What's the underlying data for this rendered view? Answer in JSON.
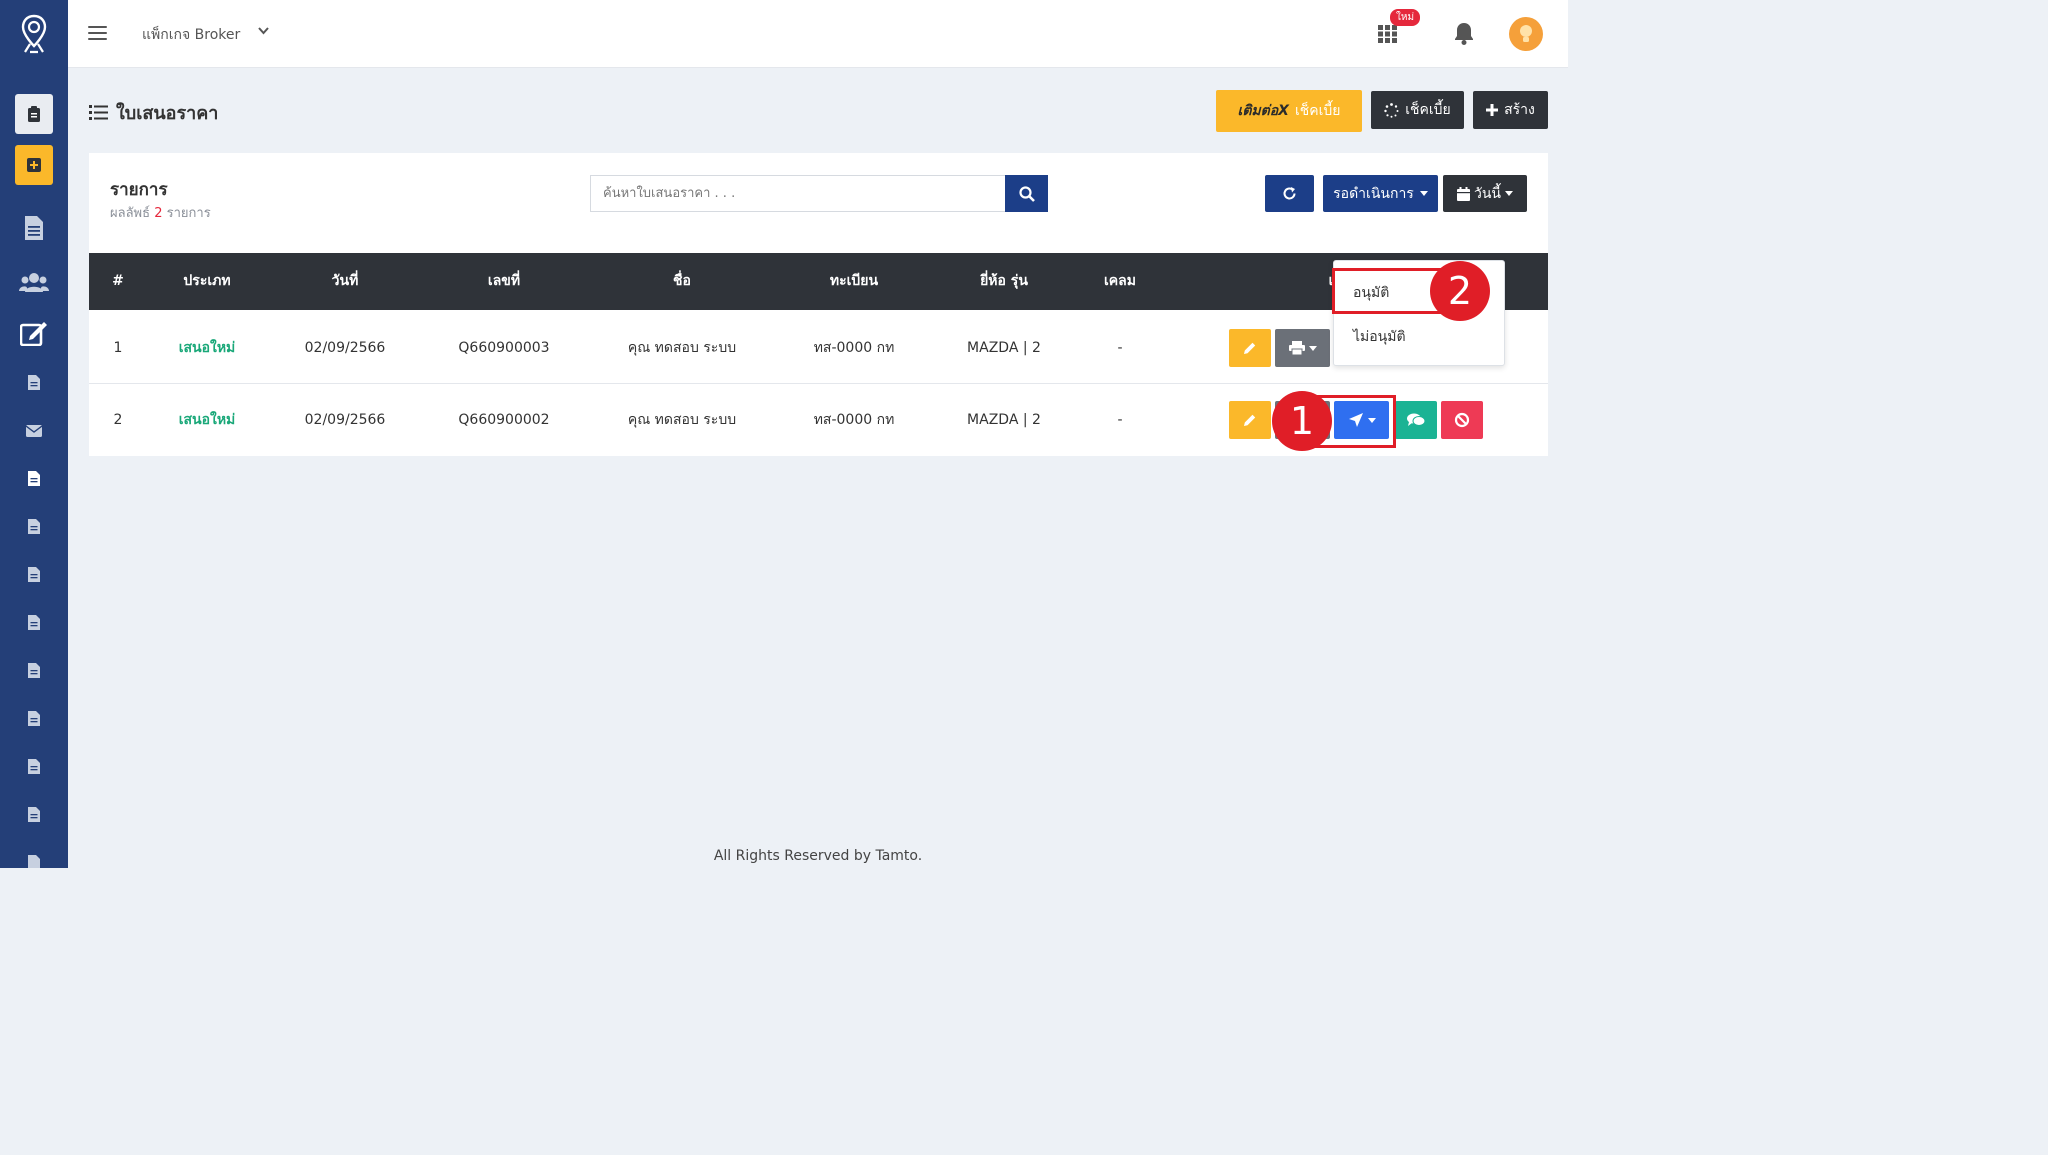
{
  "topbar": {
    "package_label": "แพ็กเกจ Broker",
    "new_badge": "ใหม่"
  },
  "page": {
    "title": "ใบเสนอราคา",
    "btn_brand": "เติมต่อ",
    "btn_brand_label": "เช็คเบี้ย",
    "btn_check_label": "เช็คเบี้ย",
    "btn_create_label": "สร้าง"
  },
  "card": {
    "title": "รายการ",
    "result_prefix": "ผลลัพธ์",
    "result_count": "2",
    "result_suffix": "รายการ",
    "search_placeholder": "ค้นหาใบเสนอราคา . . .",
    "status_filter": "รอดำเนินการ",
    "date_filter": "วันนี้"
  },
  "table": {
    "headers": [
      "#",
      "ประเภท",
      "วันที่",
      "เลขที่",
      "ชื่อ",
      "ทะเบียน",
      "ยี่ห้อ รุ่น",
      "เคลม",
      "เ"
    ],
    "rows": [
      {
        "no": "1",
        "type": "เสนอใหม่",
        "date": "02/09/2566",
        "number": "Q660900003",
        "name": "คุณ ทดสอบ ระบบ",
        "plate": "ทส-0000 กท",
        "brand": "MAZDA | 2",
        "claim": "-"
      },
      {
        "no": "2",
        "type": "เสนอใหม่",
        "date": "02/09/2566",
        "number": "Q660900002",
        "name": "คุณ ทดสอบ ระบบ",
        "plate": "ทส-0000 กท",
        "brand": "MAZDA | 2",
        "claim": "-"
      }
    ]
  },
  "dropdown": {
    "approve": "อนุมัติ",
    "reject": "ไม่อนุมัติ"
  },
  "annotations": {
    "step1": "1",
    "step2": "2"
  },
  "footer": "All Rights Reserved by Tamto.",
  "colors": {
    "sidebar": "#243f78",
    "primary": "#1c3e88",
    "dark": "#2f3339",
    "yellow": "#fbb82a",
    "green": "#1aa879",
    "red": "#e01e27"
  }
}
